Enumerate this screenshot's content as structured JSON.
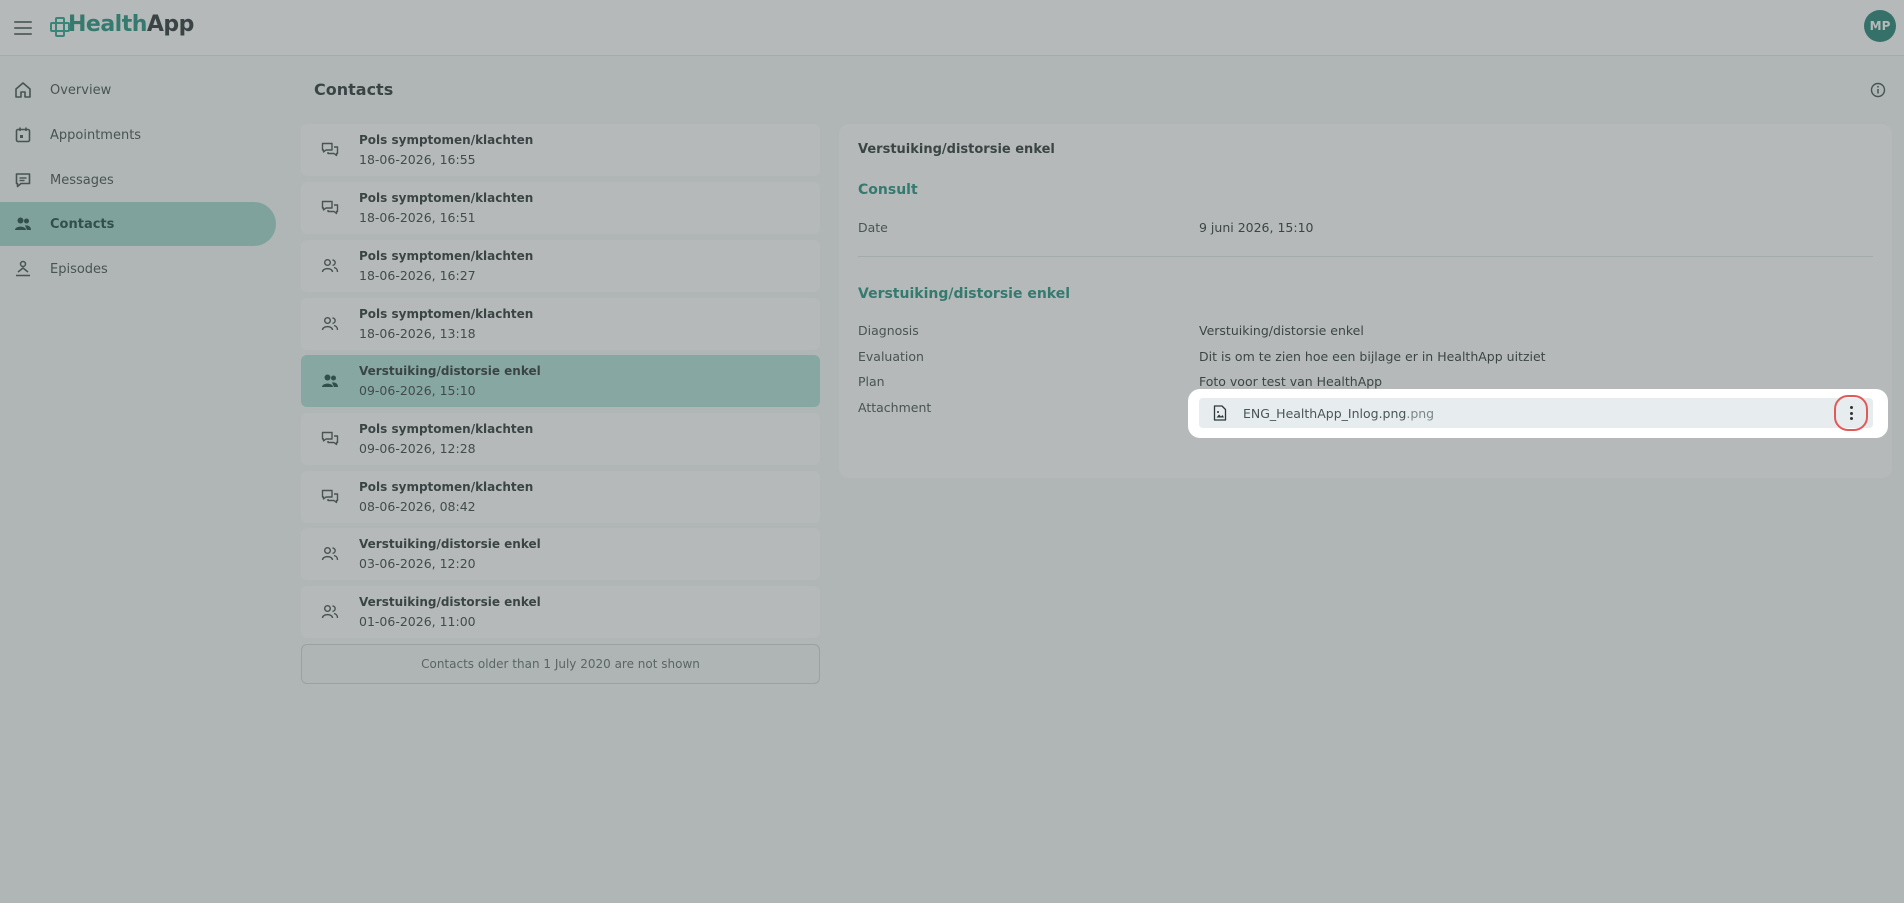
{
  "header": {
    "app_name_part1": "Health",
    "app_name_part2": "App",
    "avatar_initials": "MP"
  },
  "sidebar": {
    "items": [
      {
        "label": "Overview",
        "icon": "home-icon"
      },
      {
        "label": "Appointments",
        "icon": "calendar-icon"
      },
      {
        "label": "Messages",
        "icon": "chat-icon"
      },
      {
        "label": "Contacts",
        "icon": "people-icon",
        "active": true
      },
      {
        "label": "Episodes",
        "icon": "episodes-icon"
      }
    ]
  },
  "page": {
    "title": "Contacts"
  },
  "contacts": [
    {
      "title": "Pols symptomen/klachten",
      "date": "18-06-2026, 16:55",
      "icon": "chat-bubbles-icon"
    },
    {
      "title": "Pols symptomen/klachten",
      "date": "18-06-2026, 16:51",
      "icon": "chat-bubbles-icon"
    },
    {
      "title": "Pols symptomen/klachten",
      "date": "18-06-2026, 16:27",
      "icon": "people-icon"
    },
    {
      "title": "Pols symptomen/klachten",
      "date": "18-06-2026, 13:18",
      "icon": "people-icon"
    },
    {
      "title": "Verstuiking/distorsie enkel",
      "date": "09-06-2026, 15:10",
      "icon": "people-icon",
      "active": true
    },
    {
      "title": "Pols symptomen/klachten",
      "date": "09-06-2026, 12:28",
      "icon": "chat-bubbles-icon"
    },
    {
      "title": "Pols symptomen/klachten",
      "date": "08-06-2026, 08:42",
      "icon": "chat-bubbles-icon"
    },
    {
      "title": "Verstuiking/distorsie enkel",
      "date": "03-06-2026, 12:20",
      "icon": "people-icon"
    },
    {
      "title": "Verstuiking/distorsie enkel",
      "date": "01-06-2026, 11:00",
      "icon": "people-icon"
    }
  ],
  "contacts_note": "Contacts older than 1 July 2020 are not shown",
  "detail": {
    "title": "Verstuiking/distorsie enkel",
    "consult_heading": "Consult",
    "date_label": "Date",
    "date_value": "9 juni 2026, 15:10",
    "episode_heading": "Verstuiking/distorsie enkel",
    "diagnosis_label": "Diagnosis",
    "diagnosis_value": "Verstuiking/distorsie enkel",
    "evaluation_label": "Evaluation",
    "evaluation_value": "Dit is om te zien hoe een bijlage er in HealthApp uitziet",
    "plan_label": "Plan",
    "plan_value": "Foto voor test van HealthApp",
    "attachment_label": "Attachment",
    "attachment_name": "ENG_HealthApp_Inlog.png",
    "attachment_ext": ".png"
  },
  "colors": {
    "brand": "#178c78",
    "active_bg": "#9fd6cb",
    "highlight_ring": "#e05a5a"
  }
}
